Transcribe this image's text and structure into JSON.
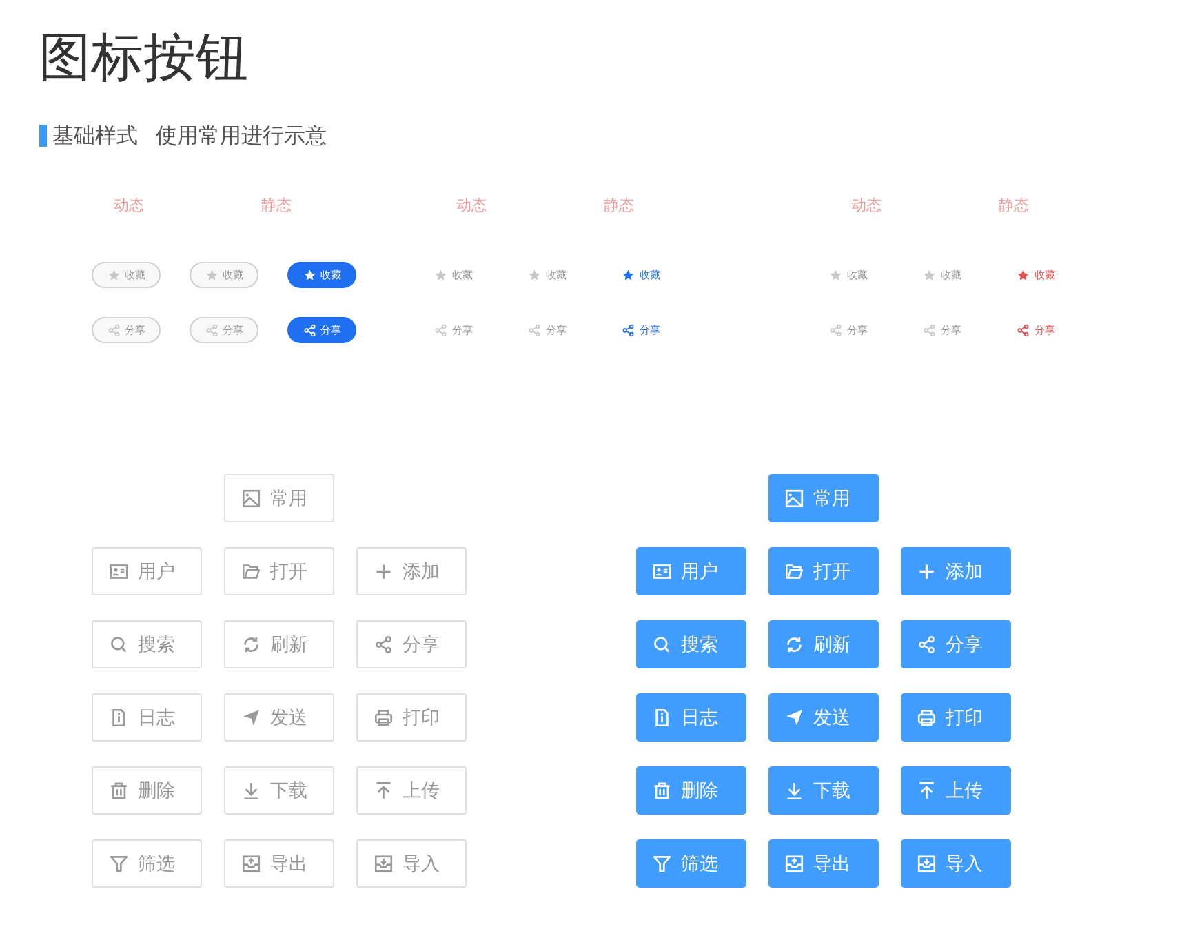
{
  "title": "图标按钮",
  "section": {
    "title": "基础样式",
    "note": "使用常用进行示意"
  },
  "groups": [
    {
      "kind": "pill",
      "color": "#1f6ff0",
      "labels": [
        "动态",
        "静态"
      ],
      "rows": [
        {
          "items": [
            {
              "kind": "star",
              "label": "收藏",
              "selected": false
            },
            {
              "kind": "star",
              "label": "收藏",
              "selected": false
            },
            {
              "kind": "star",
              "label": "收藏",
              "selected": true
            }
          ]
        },
        {
          "items": [
            {
              "kind": "share",
              "label": "分享",
              "selected": false
            },
            {
              "kind": "share",
              "label": "分享",
              "selected": false
            },
            {
              "kind": "share",
              "label": "分享",
              "selected": true
            }
          ]
        }
      ]
    },
    {
      "kind": "plain",
      "color": "#2170f0",
      "labels": [
        "动态",
        "静态"
      ],
      "rows": [
        {
          "items": [
            {
              "kind": "star",
              "label": "收藏",
              "selected": false
            },
            {
              "kind": "star",
              "label": "收藏",
              "selected": false
            },
            {
              "kind": "star",
              "label": "收藏",
              "selected": true
            }
          ]
        },
        {
          "items": [
            {
              "kind": "share",
              "label": "分享",
              "selected": false
            },
            {
              "kind": "share",
              "label": "分享",
              "selected": false
            },
            {
              "kind": "share",
              "label": "分享",
              "selected": true
            }
          ]
        }
      ]
    },
    {
      "kind": "plain",
      "color": "#e84c4c",
      "labels": [
        "动态",
        "静态"
      ],
      "rows": [
        {
          "items": [
            {
              "kind": "star",
              "label": "收藏",
              "selected": false
            },
            {
              "kind": "star",
              "label": "收藏",
              "selected": false
            },
            {
              "kind": "star",
              "label": "收藏",
              "selected": true
            }
          ]
        },
        {
          "items": [
            {
              "kind": "share",
              "label": "分享",
              "selected": false
            },
            {
              "kind": "share",
              "label": "分享",
              "selected": false
            },
            {
              "kind": "share",
              "label": "分享",
              "selected": true
            }
          ]
        }
      ]
    }
  ],
  "button_sets": [
    {
      "kind": "outline",
      "buttons": [
        {
          "kind": "image",
          "label": "常用"
        },
        {
          "kind": "user",
          "label": "用户"
        },
        {
          "kind": "folder",
          "label": "打开"
        },
        {
          "kind": "plus",
          "label": "添加"
        },
        {
          "kind": "search",
          "label": "搜索"
        },
        {
          "kind": "refresh",
          "label": "刷新"
        },
        {
          "kind": "share",
          "label": "分享"
        },
        {
          "kind": "info",
          "label": "日志"
        },
        {
          "kind": "send",
          "label": "发送"
        },
        {
          "kind": "print",
          "label": "打印"
        },
        {
          "kind": "trash",
          "label": "删除"
        },
        {
          "kind": "download",
          "label": "下载"
        },
        {
          "kind": "upload",
          "label": "上传"
        },
        {
          "kind": "filter",
          "label": "筛选"
        },
        {
          "kind": "export",
          "label": "导出"
        },
        {
          "kind": "import",
          "label": "导入"
        }
      ]
    },
    {
      "kind": "filled",
      "buttons": [
        {
          "kind": "image",
          "label": "常用"
        },
        {
          "kind": "user",
          "label": "用户"
        },
        {
          "kind": "folder",
          "label": "打开"
        },
        {
          "kind": "plus",
          "label": "添加"
        },
        {
          "kind": "search",
          "label": "搜索"
        },
        {
          "kind": "refresh",
          "label": "刷新"
        },
        {
          "kind": "share",
          "label": "分享"
        },
        {
          "kind": "info",
          "label": "日志"
        },
        {
          "kind": "send",
          "label": "发送"
        },
        {
          "kind": "print",
          "label": "打印"
        },
        {
          "kind": "trash",
          "label": "删除"
        },
        {
          "kind": "download",
          "label": "下载"
        },
        {
          "kind": "upload",
          "label": "上传"
        },
        {
          "kind": "filter",
          "label": "筛选"
        },
        {
          "kind": "export",
          "label": "导出"
        },
        {
          "kind": "import",
          "label": "导入"
        }
      ]
    }
  ]
}
